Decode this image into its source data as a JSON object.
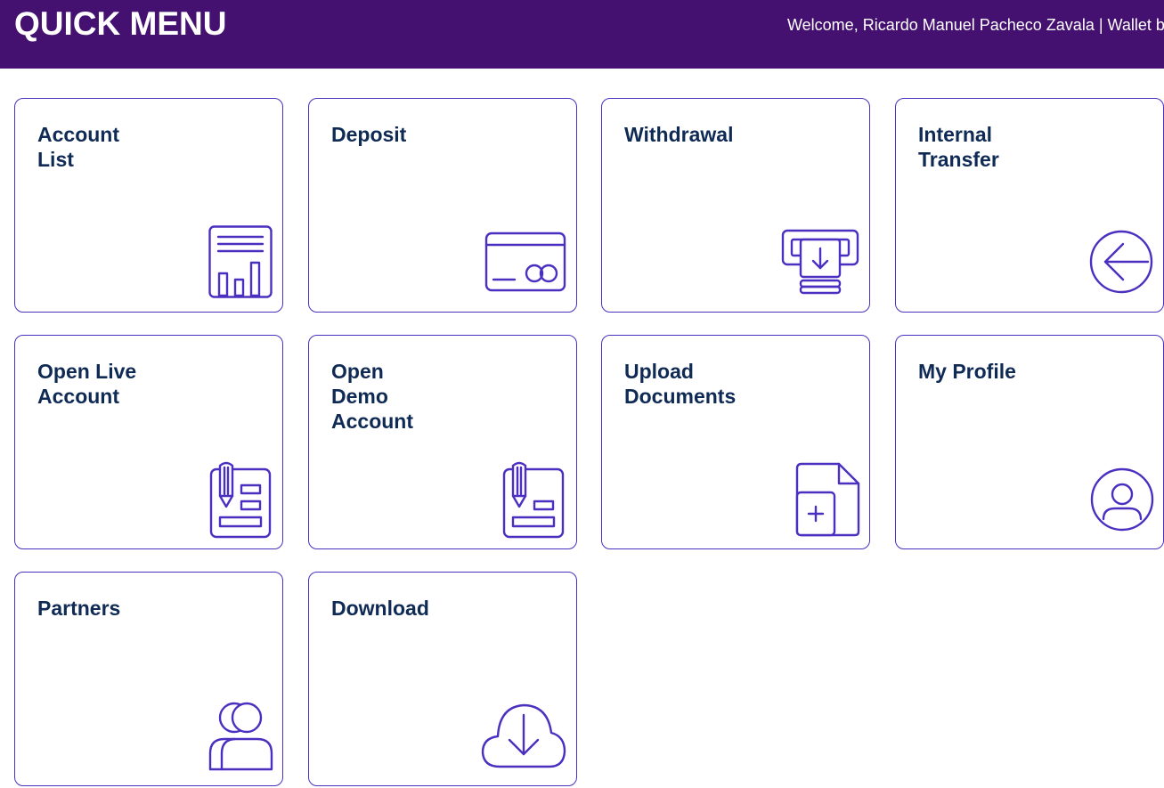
{
  "header": {
    "title": "QUICK MENU",
    "welcome_text": "Welcome, Ricardo Manuel Pacheco Zavala | Wallet bala"
  },
  "colors": {
    "header_bg": "#451170",
    "tile_border": "#4b2fc0",
    "icon_stroke": "#4b2fc0",
    "label_text": "#0f2a55"
  },
  "tiles": [
    {
      "label": "Account\nList",
      "icon": "report-chart-icon"
    },
    {
      "label": "Deposit",
      "icon": "credit-card-icon"
    },
    {
      "label": "Withdrawal",
      "icon": "atm-withdrawal-icon"
    },
    {
      "label": "Internal\nTransfer",
      "icon": "circle-arrow-left-icon"
    },
    {
      "label": "Open Live\nAccount",
      "icon": "form-pencil-icon"
    },
    {
      "label": "Open\nDemo\nAccount",
      "icon": "form-pencil-icon"
    },
    {
      "label": "Upload\nDocuments",
      "icon": "document-add-icon"
    },
    {
      "label": "My Profile",
      "icon": "user-circle-icon"
    },
    {
      "label": "Partners",
      "icon": "partners-users-icon"
    },
    {
      "label": "Download",
      "icon": "cloud-download-icon"
    }
  ]
}
